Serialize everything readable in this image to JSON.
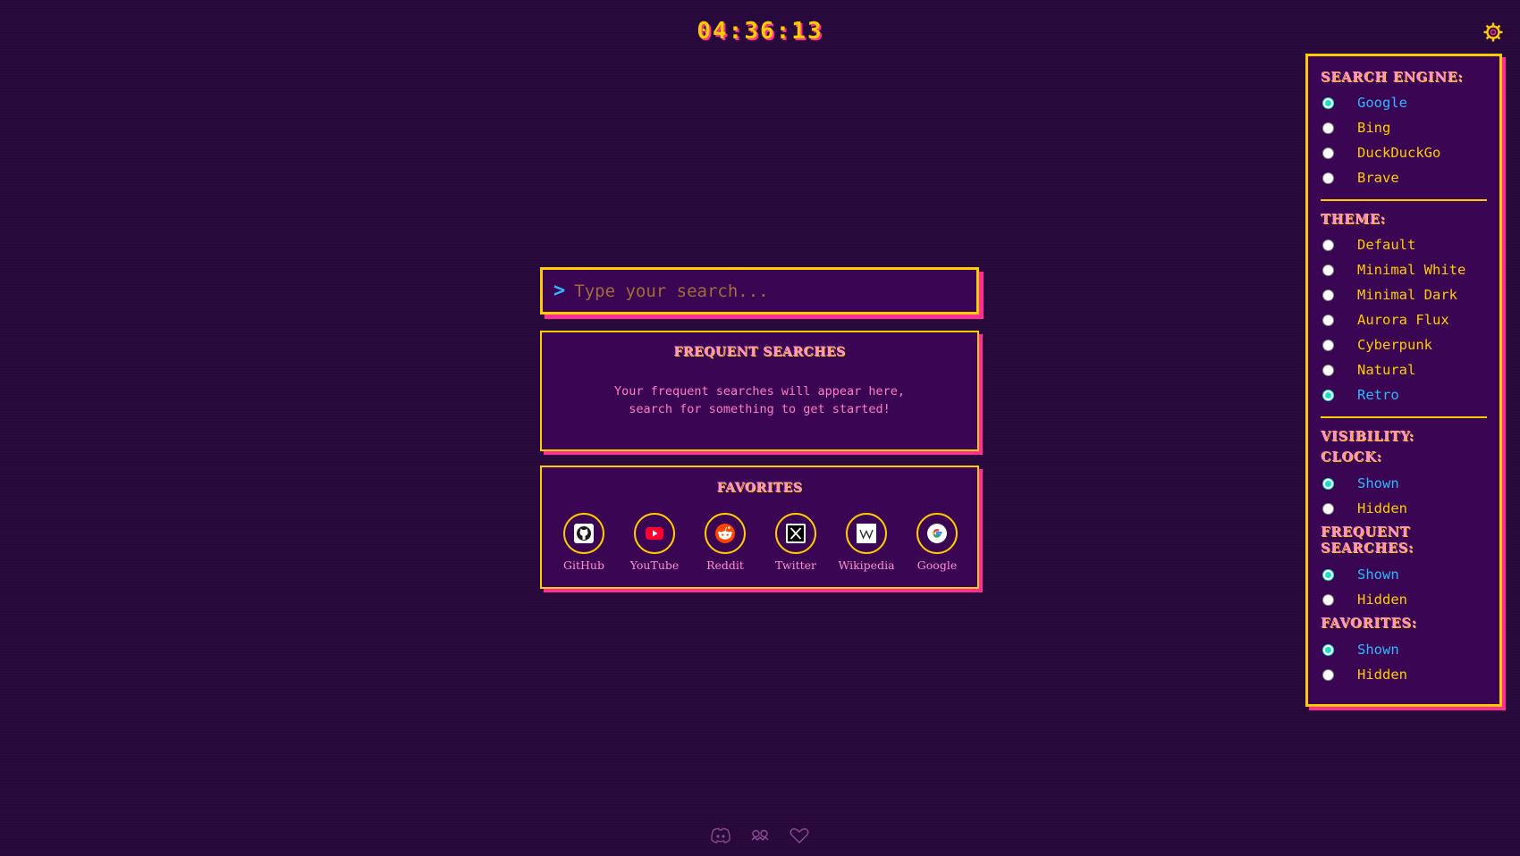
{
  "clock": {
    "time": "04:36:13"
  },
  "settings_button": {
    "icon": "gear-icon"
  },
  "search": {
    "prompt": ">",
    "placeholder": "Type your search..."
  },
  "frequent": {
    "title": "FREQUENT SEARCHES",
    "message_line1": "Your frequent searches will appear here,",
    "message_line2": "search for something to get started!"
  },
  "favorites": {
    "title": "FAVORITES",
    "items": [
      {
        "label": "GitHub",
        "icon": "github-icon"
      },
      {
        "label": "YouTube",
        "icon": "youtube-icon"
      },
      {
        "label": "Reddit",
        "icon": "reddit-icon"
      },
      {
        "label": "Twitter",
        "icon": "twitter-x-icon"
      },
      {
        "label": "Wikipedia",
        "icon": "wikipedia-icon"
      },
      {
        "label": "Google",
        "icon": "google-icon"
      }
    ]
  },
  "settings": {
    "search_engine": {
      "title": "SEARCH ENGINE:",
      "options": [
        "Google",
        "Bing",
        "DuckDuckGo",
        "Brave"
      ],
      "selected": "Google"
    },
    "theme": {
      "title": "THEME:",
      "options": [
        "Default",
        "Minimal White",
        "Minimal Dark",
        "Aurora Flux",
        "Cyberpunk",
        "Natural",
        "Retro"
      ],
      "selected": "Retro"
    },
    "visibility": {
      "title": "VISIBILITY:",
      "clock": {
        "title": "CLOCK:",
        "shown": "Shown",
        "hidden": "Hidden",
        "selected": "Shown"
      },
      "frequent_searches": {
        "title_line1": "FREQUENT",
        "title_line2": "SEARCHES:",
        "shown": "Shown",
        "hidden": "Hidden",
        "selected": "Shown"
      },
      "favorites": {
        "title": "FAVORITES:",
        "shown": "Shown",
        "hidden": "Hidden",
        "selected": "Shown"
      }
    }
  },
  "footer": {
    "icons": [
      "discord-icon",
      "owl-icon",
      "heart-icon"
    ]
  },
  "colors": {
    "background": "#2a0a3e",
    "panel": "#3a0553",
    "accent_yellow": "#ffcc00",
    "accent_pink": "#ff2d95",
    "selected_blue": "#33b6ff",
    "radio_teal": "#18e0c8"
  }
}
